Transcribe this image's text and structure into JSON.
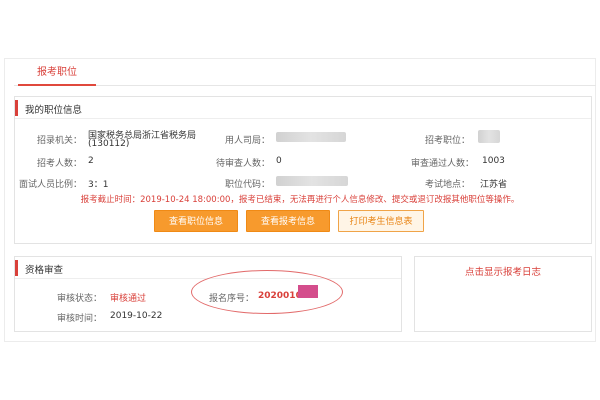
{
  "tabs": {
    "active": "报考职位"
  },
  "position_info": {
    "title": "我的职位信息",
    "fields": {
      "agency_label": "招录机关：",
      "agency_value_line1": "国家税务总局浙江省税务局",
      "agency_value_line2": "(130112)",
      "employer_label": "用人司局：",
      "apply_position_label": "招考职位：",
      "recruit_count_label": "招考人数：",
      "recruit_count_value": "2",
      "pending_count_label": "待审查人数：",
      "pending_count_value": "0",
      "approved_count_label": "审查通过人数：",
      "approved_count_value": "1003",
      "interview_ratio_label": "面试人员比例：",
      "interview_ratio_value": "3：1",
      "position_code_label": "职位代码：",
      "exam_location_label": "考试地点：",
      "exam_location_value": "江苏省"
    },
    "notice": "报考截止时间：2019-10-24 18:00:00，报考已结束，无法再进行个人信息修改、提交或退订改报其他职位等操作。",
    "buttons": {
      "view_position": "查看职位信息",
      "view_application": "查看报考信息",
      "print_info": "打印考生信息表"
    }
  },
  "qualification": {
    "title": "资格审查",
    "status_label": "审核状态：",
    "status_value": "审核通过",
    "time_label": "审核时间：",
    "time_value": "2019-10-22",
    "reg_no_label": "报名序号：",
    "reg_no_value": "2020010"
  },
  "log_link": {
    "label": "点击显示报考日志"
  },
  "colors": {
    "accent_red": "#d9403a",
    "button_orange": "#f79a2d",
    "annotation_circle": "#e26a6a",
    "redaction_pink": "#d44d8c"
  }
}
